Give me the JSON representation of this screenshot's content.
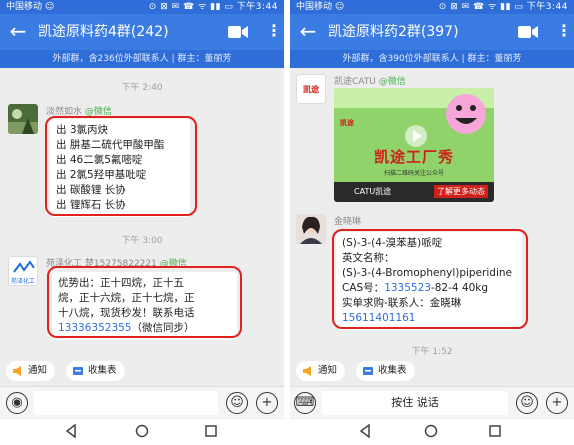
{
  "left": {
    "status": {
      "carrier": "中国移动 ☺",
      "icons": "⊙ ⊠ ✉ ☎ ᯤ ▮▮ ▭ 下午3:44"
    },
    "title": "凯途原料药4群(242)",
    "subtitle": "外部群，含236位外部联系人 | 群主：董丽芳",
    "time1": "下午 2:40",
    "msg1": {
      "sender": "淡然如水",
      "sender_tag": "@微信",
      "lines": [
        "出 3氯丙炔",
        "出 肼基二硫代甲酸甲酯",
        "出 46二氯5氟嘧啶",
        "出 2氯5羟甲基吡啶",
        "出 碳酸锂 长协",
        "出 锂辉石 长协"
      ]
    },
    "time2": "下午 3:00",
    "msg2": {
      "sender": "苑泽化工 楚15275822221",
      "sender_tag": "@微信",
      "avatar_text": "苑泽化工",
      "lines": [
        "优势出：正十四烷，正十五",
        "烷，正十六烷，正十七烷，正",
        "十八烷，现货秒发！联系电话"
      ],
      "phone": "13336352355",
      "phone_suffix": "（微信同步）"
    },
    "chip1": "通知",
    "chip2": "收集表"
  },
  "right": {
    "status": {
      "carrier": "中国移动 ☺",
      "icons": "⊙ ⊠ ✉ ☎ ᯤ ▮▮ ▭ 下午3:44"
    },
    "title": "凯途原料药2群(397)",
    "subtitle": "外部群，含390位外部联系人 | 群主：董丽芳",
    "msg1": {
      "sender": "凯途CATU",
      "sender_tag": "@微信",
      "avatar_text": "凯途",
      "card": {
        "logo": "凯途",
        "headline": "凯途工厂秀",
        "small": "扫描二维码关注公众号",
        "source": "CATU凯途",
        "more": "了解更多动态"
      }
    },
    "msg2": {
      "sender": "金晓琳",
      "lines": [
        "(S)-3-(4-溴苯基)哌啶",
        "英文名称：",
        "(S)-3-(4-Bromophenyl)piperidine"
      ],
      "cas_prefix": "CAS号：",
      "cas_link": "1335523",
      "cas_rest": "-82-4  40kg",
      "contact": "实单求购-联系人：金晓琳",
      "phone": "15611401161"
    },
    "time_bottom": "下午 1:52",
    "chip1": "通知",
    "chip2": "收集表",
    "hold_button": "按住 说话"
  },
  "colors": {
    "header": "#3b7ce2",
    "status": "#2f6ed8",
    "highlight": "#e0211d",
    "link": "#2f6ed8",
    "wechat": "#4caf50"
  }
}
